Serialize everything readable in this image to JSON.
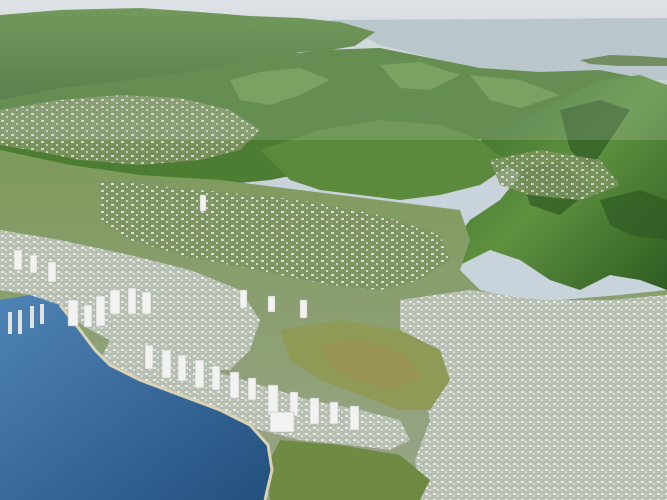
{
  "image": {
    "kind": "aerial 3D city terrain render",
    "colors": {
      "sky": "#d7dde2",
      "distant_haze": "#b9c4c7",
      "mountain_dark": "#2f5a26",
      "mountain_mid": "#4f7f35",
      "mountain_light": "#7aa55a",
      "plain_green": "#6f8f45",
      "urban_gray": "#c9cfc8",
      "building_white": "#eef0ee",
      "park_olive": "#8c9a4e",
      "ocean_deep": "#2b5c8c",
      "ocean_shallow": "#5d8fbf",
      "beach": "#cfc7a4"
    }
  }
}
